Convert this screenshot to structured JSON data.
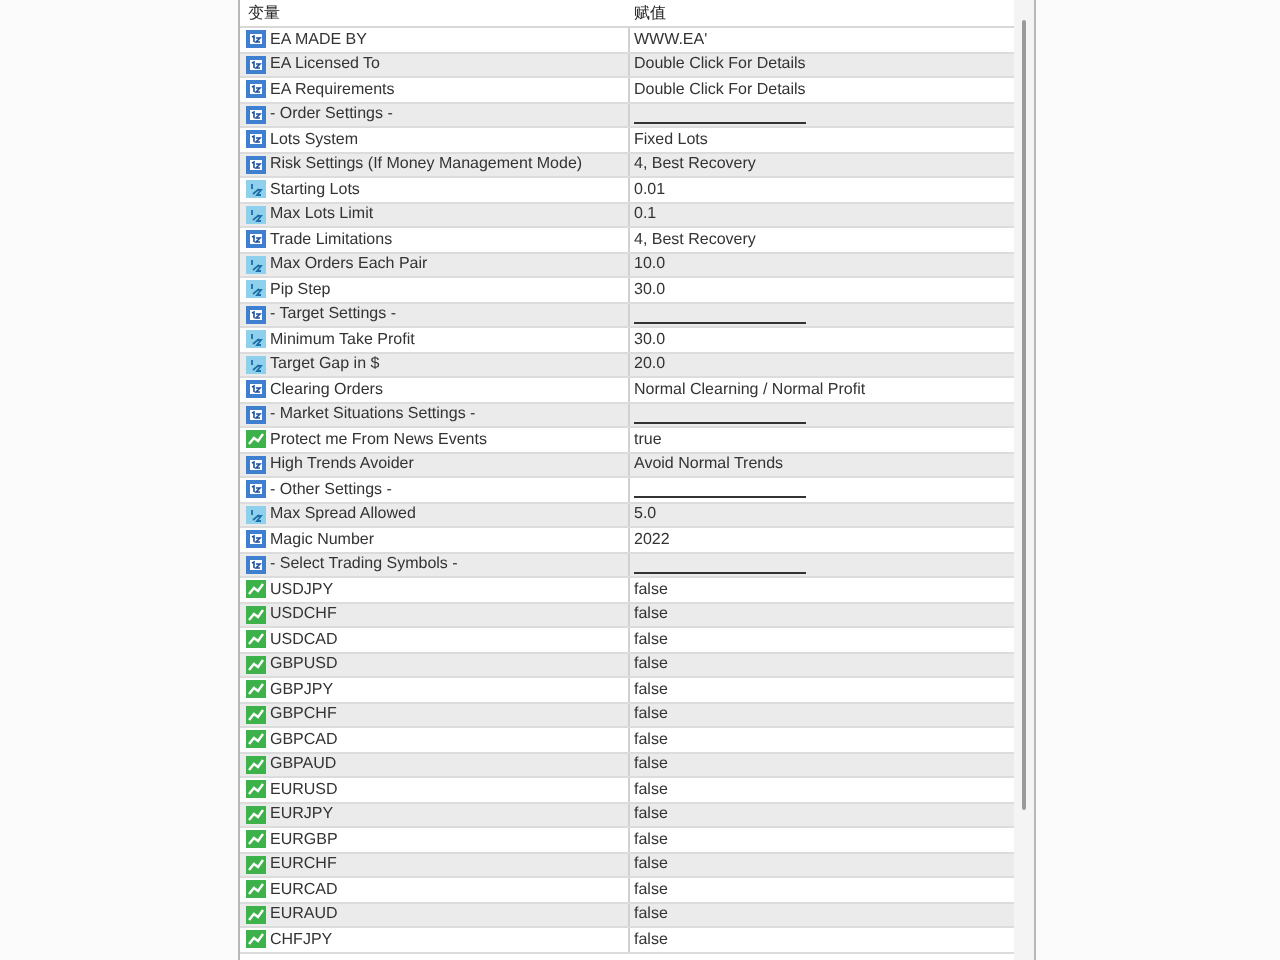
{
  "table": {
    "columns": [
      "变量",
      "赋值"
    ],
    "rows": [
      {
        "name": "EA MADE BY",
        "kind": "int",
        "value": "WWW.EA'"
      },
      {
        "name": "EA Licensed To",
        "kind": "int",
        "value": "Double Click For Details"
      },
      {
        "name": "EA Requirements",
        "kind": "int",
        "value": "Double Click For Details"
      },
      {
        "name": "- Order Settings -",
        "kind": "section"
      },
      {
        "name": "Lots System",
        "kind": "int",
        "value": "Fixed Lots"
      },
      {
        "name": "Risk Settings (If Money Management Mode)",
        "kind": "int",
        "value": "4, Best Recovery"
      },
      {
        "name": "Starting Lots",
        "kind": "double",
        "value": "0.01"
      },
      {
        "name": "Max Lots Limit",
        "kind": "double",
        "value": "0.1"
      },
      {
        "name": "Trade Limitations",
        "kind": "int",
        "value": "4, Best Recovery"
      },
      {
        "name": "Max Orders Each Pair",
        "kind": "double",
        "value": "10.0"
      },
      {
        "name": "Pip Step",
        "kind": "double",
        "value": "30.0"
      },
      {
        "name": "- Target Settings -",
        "kind": "section"
      },
      {
        "name": "Minimum Take Profit",
        "kind": "double",
        "value": "30.0"
      },
      {
        "name": "Target Gap in $",
        "kind": "double",
        "value": "20.0"
      },
      {
        "name": "Clearing Orders",
        "kind": "int",
        "value": "Normal Clearning / Normal Profit"
      },
      {
        "name": "- Market Situations Settings -",
        "kind": "section"
      },
      {
        "name": "Protect me From News Events",
        "kind": "bool",
        "value": "true"
      },
      {
        "name": "High Trends Avoider",
        "kind": "int",
        "value": "Avoid Normal Trends"
      },
      {
        "name": "- Other Settings -",
        "kind": "section"
      },
      {
        "name": "Max Spread Allowed",
        "kind": "double",
        "value": "5.0"
      },
      {
        "name": "Magic Number",
        "kind": "int",
        "value": "2022"
      },
      {
        "name": "- Select Trading Symbols -",
        "kind": "section"
      },
      {
        "name": "USDJPY",
        "kind": "bool",
        "value": "false"
      },
      {
        "name": "USDCHF",
        "kind": "bool",
        "value": "false"
      },
      {
        "name": "USDCAD",
        "kind": "bool",
        "value": "false"
      },
      {
        "name": "GBPUSD",
        "kind": "bool",
        "value": "false"
      },
      {
        "name": "GBPJPY",
        "kind": "bool",
        "value": "false"
      },
      {
        "name": "GBPCHF",
        "kind": "bool",
        "value": "false"
      },
      {
        "name": "GBPCAD",
        "kind": "bool",
        "value": "false"
      },
      {
        "name": "GBPAUD",
        "kind": "bool",
        "value": "false"
      },
      {
        "name": "EURUSD",
        "kind": "bool",
        "value": "false"
      },
      {
        "name": "EURJPY",
        "kind": "bool",
        "value": "false"
      },
      {
        "name": "EURGBP",
        "kind": "bool",
        "value": "false"
      },
      {
        "name": "EURCHF",
        "kind": "bool",
        "value": "false"
      },
      {
        "name": "EURCAD",
        "kind": "bool",
        "value": "false"
      },
      {
        "name": "EURAUD",
        "kind": "bool",
        "value": "false"
      },
      {
        "name": "CHFJPY",
        "kind": "bool",
        "value": "false"
      }
    ]
  }
}
